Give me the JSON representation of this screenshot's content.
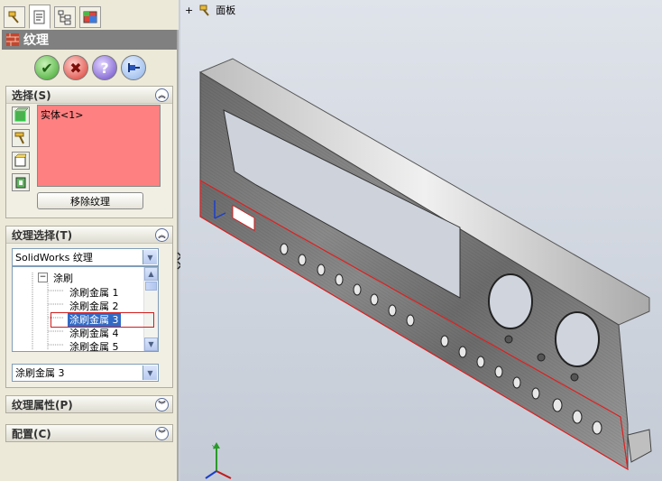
{
  "property_manager": {
    "title": "纹理",
    "ok_button": "✔",
    "cancel_button": "✖",
    "help_button": "?",
    "pin_button": "pin",
    "selection": {
      "header": "选择(S)",
      "selected_item": "实体<1>",
      "remove_button": "移除纹理"
    },
    "texture_selection": {
      "header": "纹理选择(T)",
      "library": "SolidWorks 纹理",
      "tree": {
        "folder": "涂刷",
        "items": [
          "涂刷金属 1",
          "涂刷金属 2",
          "涂刷金属 3",
          "涂刷金属 4",
          "涂刷金属 5"
        ],
        "selected_index": 2
      },
      "current_texture": "涂刷金属 3"
    },
    "texture_properties_header": "纹理属性(P)",
    "configurations_header": "配置(C)"
  },
  "viewport": {
    "breadcrumb_expand": "+",
    "breadcrumb_label": "面板"
  },
  "triad": {
    "x": "X",
    "y": "Y",
    "z": "Z"
  },
  "colors": {
    "selection_fill": "#ff8080",
    "highlight": "#d21b1b",
    "titlebar": "#808080"
  },
  "icons": [
    "feature-manager-icon",
    "property-manager-icon",
    "configuration-manager-icon",
    "display-manager-icon",
    "texture-icon",
    "ok-icon",
    "cancel-icon",
    "help-icon",
    "pin-icon"
  ]
}
